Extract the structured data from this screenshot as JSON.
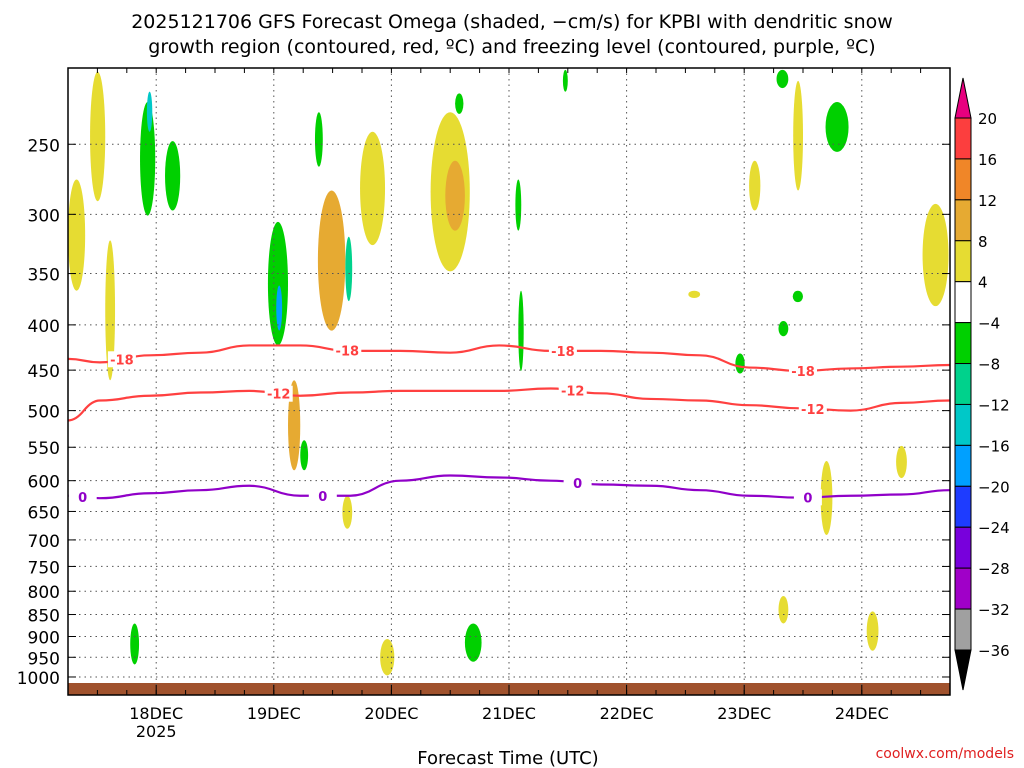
{
  "chart_data": {
    "type": "heatmap",
    "title_line1": "2025121706 GFS Forecast Omega (shaded, −cm/s) for KPBI with dendritic snow",
    "title_line2": "growth region (contoured, red, ºC) and freezing level (contoured, purple, ºC)",
    "xlabel": "Forecast Time (UTC)",
    "credit": "coolwx.com/models",
    "x_unit": "hours since 17DEC 06Z",
    "xlim": [
      0,
      180
    ],
    "x_ticks": [
      {
        "hour": 18,
        "label": "18DEC",
        "sublabel": "2025"
      },
      {
        "hour": 42,
        "label": "19DEC"
      },
      {
        "hour": 66,
        "label": "20DEC"
      },
      {
        "hour": 90,
        "label": "21DEC"
      },
      {
        "hour": 114,
        "label": "22DEC"
      },
      {
        "hour": 138,
        "label": "23DEC"
      },
      {
        "hour": 162,
        "label": "24DEC"
      }
    ],
    "y_unit": "hPa",
    "ylim": [
      205,
      1048
    ],
    "y_ticks": [
      "250",
      "300",
      "350",
      "400",
      "450",
      "500",
      "550",
      "600",
      "650",
      "700",
      "750",
      "800",
      "850",
      "900",
      "950",
      "1000"
    ],
    "colorbar": {
      "labels": [
        "20",
        "16",
        "12",
        "8",
        "4",
        "−4",
        "−8",
        "−12",
        "−16",
        "−20",
        "−24",
        "−28",
        "−32",
        "−36"
      ],
      "over_color": "#e8007f",
      "under_color": "#000000",
      "bins": [
        {
          "min": 16,
          "max": 20,
          "color": "#fc3e3e"
        },
        {
          "min": 12,
          "max": 16,
          "color": "#f08628"
        },
        {
          "min": 8,
          "max": 12,
          "color": "#e6aa32"
        },
        {
          "min": 4,
          "max": 8,
          "color": "#e6dc32"
        },
        {
          "min": -4,
          "max": 4,
          "color": "#ffffff"
        },
        {
          "min": -8,
          "max": -4,
          "color": "#00d000"
        },
        {
          "min": -12,
          "max": -8,
          "color": "#00d28c"
        },
        {
          "min": -16,
          "max": -12,
          "color": "#00c8c8"
        },
        {
          "min": -20,
          "max": -16,
          "color": "#00a0ff"
        },
        {
          "min": -24,
          "max": -20,
          "color": "#1e3cff"
        },
        {
          "min": -28,
          "max": -24,
          "color": "#7800dc"
        },
        {
          "min": -32,
          "max": -28,
          "color": "#a000c8"
        },
        {
          "min": -36,
          "max": -32,
          "color": "#a0a0a0"
        }
      ]
    },
    "omega_regions": [
      {
        "h0": 0,
        "h1": 3.5,
        "p0": 274,
        "p1": 366,
        "v": 5
      },
      {
        "h0": 4.5,
        "h1": 7.6,
        "p0": 207,
        "p1": 290,
        "v": 6
      },
      {
        "h0": 7.6,
        "h1": 9.6,
        "p0": 321,
        "p1": 462,
        "v": 5
      },
      {
        "h0": 14.7,
        "h1": 17.8,
        "p0": 224,
        "p1": 301,
        "v": -6
      },
      {
        "h0": 16.1,
        "h1": 17.2,
        "p0": 218,
        "p1": 242,
        "v": -14
      },
      {
        "h0": 19.8,
        "h1": 22.9,
        "p0": 248,
        "p1": 297,
        "v": -6
      },
      {
        "h0": 12.7,
        "h1": 14.5,
        "p0": 870,
        "p1": 968,
        "v": -6
      },
      {
        "h0": 40.8,
        "h1": 44.9,
        "p0": 306,
        "p1": 422,
        "v": -8
      },
      {
        "h0": 42.5,
        "h1": 43.7,
        "p0": 361,
        "p1": 406,
        "v": -18
      },
      {
        "h0": 44.9,
        "h1": 47.4,
        "p0": 462,
        "p1": 584,
        "v": 8
      },
      {
        "h0": 47.4,
        "h1": 49,
        "p0": 540,
        "p1": 584,
        "v": -6
      },
      {
        "h0": 50.4,
        "h1": 52,
        "p0": 230,
        "p1": 265,
        "v": -6
      },
      {
        "h0": 51,
        "h1": 56.6,
        "p0": 282,
        "p1": 406,
        "v": 8
      },
      {
        "h0": 56.6,
        "h1": 58,
        "p0": 318,
        "p1": 376,
        "v": -12
      },
      {
        "h0": 56,
        "h1": 58,
        "p0": 624,
        "p1": 680,
        "v": 6
      },
      {
        "h0": 59.6,
        "h1": 64.7,
        "p0": 242,
        "p1": 325,
        "v": 6
      },
      {
        "h0": 63.7,
        "h1": 66.6,
        "p0": 906,
        "p1": 996,
        "v": 6
      },
      {
        "h0": 74,
        "h1": 82,
        "p0": 230,
        "p1": 348,
        "v": 6
      },
      {
        "h0": 77,
        "h1": 81,
        "p0": 261,
        "p1": 313,
        "v": 10
      },
      {
        "h0": 79,
        "h1": 80.7,
        "p0": 219,
        "p1": 231,
        "v": -6
      },
      {
        "h0": 81,
        "h1": 84.4,
        "p0": 870,
        "p1": 961,
        "v": -6
      },
      {
        "h0": 91.3,
        "h1": 92.5,
        "p0": 274,
        "p1": 313,
        "v": -6
      },
      {
        "h0": 91.9,
        "h1": 93,
        "p0": 366,
        "p1": 451,
        "v": -6
      },
      {
        "h0": 101,
        "h1": 102,
        "p0": 206,
        "p1": 218,
        "v": -6
      },
      {
        "h0": 126.6,
        "h1": 129,
        "p0": 366,
        "p1": 373,
        "v": 5
      },
      {
        "h0": 136.2,
        "h1": 138.1,
        "p0": 431,
        "p1": 454,
        "v": -6
      },
      {
        "h0": 139,
        "h1": 141.3,
        "p0": 261,
        "p1": 297,
        "v": 6
      },
      {
        "h0": 144.6,
        "h1": 147,
        "p0": 206,
        "p1": 216,
        "v": -6
      },
      {
        "h0": 145,
        "h1": 147,
        "p0": 396,
        "p1": 412,
        "v": -6
      },
      {
        "h0": 145,
        "h1": 147,
        "p0": 810,
        "p1": 870,
        "v": 6
      },
      {
        "h0": 147.9,
        "h1": 150,
        "p0": 366,
        "p1": 377,
        "v": -6
      },
      {
        "h0": 148,
        "h1": 150,
        "p0": 212,
        "p1": 282,
        "v": 6
      },
      {
        "h0": 153.6,
        "h1": 156,
        "p0": 570,
        "p1": 691,
        "v": 6
      },
      {
        "h0": 154.6,
        "h1": 159.3,
        "p0": 224,
        "p1": 255,
        "v": -6
      },
      {
        "h0": 163,
        "h1": 165.4,
        "p0": 843,
        "p1": 934,
        "v": 6
      },
      {
        "h0": 169,
        "h1": 171.2,
        "p0": 548,
        "p1": 596,
        "v": 6
      },
      {
        "h0": 174.4,
        "h1": 179.7,
        "p0": 292,
        "p1": 381,
        "v": 6
      }
    ],
    "contour_hours": [
      0,
      6.5,
      16.7,
      27,
      37,
      47.4,
      57.6,
      67.8,
      78,
      88,
      98.5,
      108.7,
      118.9,
      129,
      139,
      149.5,
      159.7,
      170,
      180
    ],
    "contours": [
      {
        "label": "-18",
        "color": "#ff4040",
        "pressures": [
          437,
          441,
          433,
          430,
          422,
          422,
          428,
          428,
          430,
          422,
          428,
          428,
          430,
          433,
          447,
          451,
          448,
          446,
          444
        ],
        "label_hours": [
          11,
          57,
          101,
          150
        ]
      },
      {
        "label": "-12",
        "color": "#ff4040",
        "pressures": [
          513,
          487,
          481,
          477,
          475,
          481,
          477,
          475,
          475,
          475,
          472,
          478,
          485,
          487,
          493,
          497,
          500,
          490,
          487
        ],
        "label_hours": [
          43,
          103,
          152
        ]
      },
      {
        "label": "0",
        "color": "#9000c8",
        "pressures": [
          624,
          628,
          620,
          615,
          608,
          624,
          624,
          600,
          592,
          595,
          600,
          606,
          608,
          615,
          624,
          627,
          624,
          622,
          615
        ],
        "label_hours": [
          3,
          52,
          104,
          151
        ]
      }
    ]
  }
}
